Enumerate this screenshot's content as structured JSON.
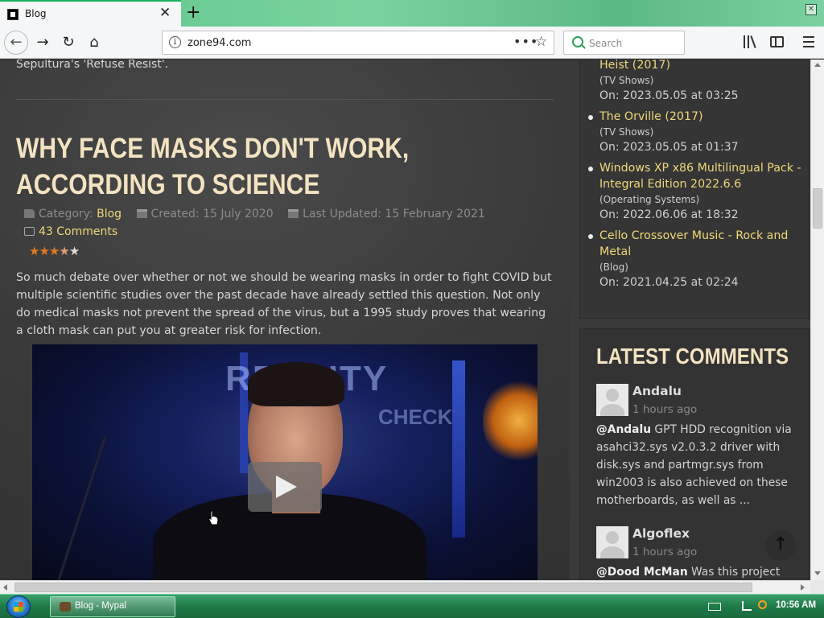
{
  "browser": {
    "tab_title": "Blog",
    "tab_close": "✕",
    "new_tab": "+",
    "url": "zone94.com",
    "url_more": "•••",
    "url_star": "☆",
    "search_placeholder": "Search",
    "window_close": "✕",
    "nav": {
      "back": "←",
      "forward": "→",
      "reload": "↻",
      "home": "⌂"
    }
  },
  "page": {
    "previous_text": "Sepultura's 'Refuse Resist'.",
    "post": {
      "title": "WHY FACE MASKS DON'T WORK, ACCORDING TO SCIENCE",
      "category_label": "Category:",
      "category": "Blog",
      "created": "Created: 15 July 2020",
      "updated": "Last Updated: 15 February 2021",
      "comments": "43 Comments",
      "rating": {
        "value": 3.5,
        "max": 5
      },
      "intro": "So much debate over whether or not we should be wearing masks in order to fight COVID but multiple scientific studies over the past decade have already settled this question. Not only do medical masks not prevent the spread of the virus, but a 1995 study proves that wearing a cloth mask can put you at greater risk for infection.",
      "video": {
        "sign_text": "REALITY",
        "sign_text2": "CHECK"
      }
    }
  },
  "sidebar": {
    "recent": [
      {
        "title": "Heist (2017)",
        "category": "(TV Shows)",
        "date": "On: 2023.05.05 at 03:25"
      },
      {
        "title": "The Orville (2017)",
        "category": "(TV Shows)",
        "date": "On: 2023.05.05 at 01:37"
      },
      {
        "title": "Windows XP x86 Multilingual Pack - Integral Edition 2022.6.6",
        "category": "(Operating Systems)",
        "date": "On: 2022.06.06 at 18:32"
      },
      {
        "title": "Cello Crossover Music - Rock and Metal",
        "category": "(Blog)",
        "date": "On: 2021.04.25 at 02:24"
      }
    ],
    "comments_heading": "LATEST COMMENTS",
    "comments": [
      {
        "author": "Andalu",
        "time": "1 hours ago",
        "mention": "@Andalu",
        "text": " GPT HDD recognition via asahci32.sys v2.0.3.2 driver with disk.sys and partmgr.sys from win2003 is also achieved on these motherboards, as well as ..."
      },
      {
        "author": "Algoflex",
        "time": "1 hours ago",
        "mention": "@Dood McMan",
        "text": " Was this project"
      }
    ],
    "to_top": "↑"
  },
  "taskbar": {
    "task_label": "Blog - Mypal",
    "clock": "10:56 AM"
  }
}
